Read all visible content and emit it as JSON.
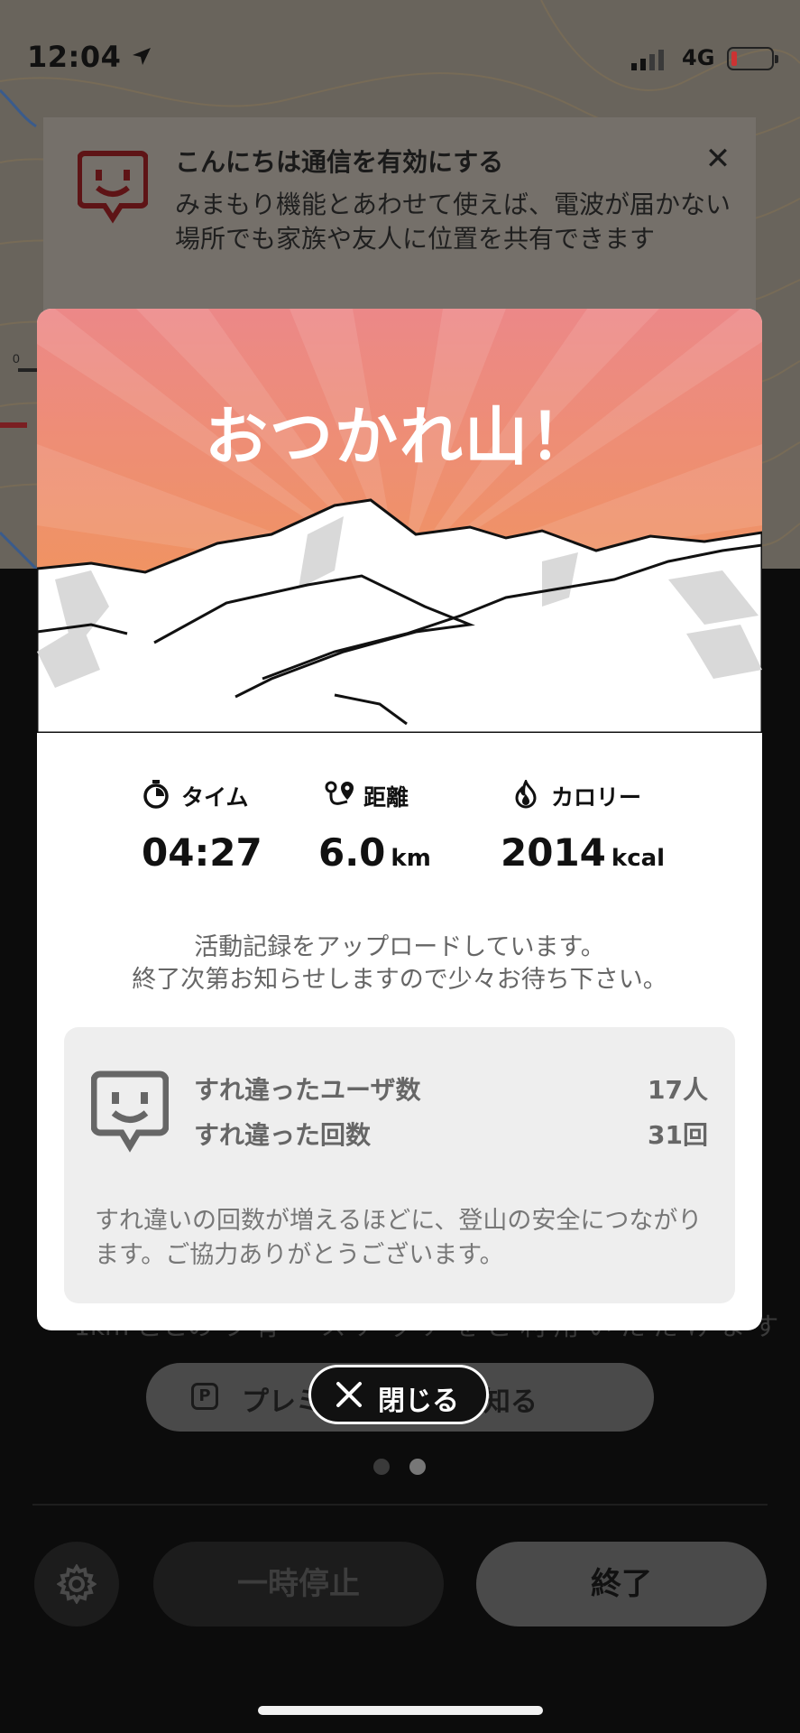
{
  "status_bar": {
    "time": "12:04",
    "network": "4G"
  },
  "notice": {
    "title": "こんにちは通信を有効にする",
    "body": "みまもり機能とあわせて使えば、電波が届かない場所でも家族や友人に位置を共有できます",
    "close_glyph": "✕"
  },
  "modal": {
    "title": "おつかれ山！",
    "stats": [
      {
        "label": "タイム",
        "value": "04:27",
        "unit": ""
      },
      {
        "label": "距離",
        "value": "6.0",
        "unit": "km"
      },
      {
        "label": "カロリー",
        "value": "2014",
        "unit": "kcal"
      }
    ],
    "upload_line1": "活動記録をアップロードしています。",
    "upload_line2": "終了次第お知らせしますので少々お待ち下さい。",
    "surechigai": {
      "rows": [
        {
          "label": "すれ違ったユーザ数",
          "value": "17人"
        },
        {
          "label": "すれ違った回数",
          "value": "31回"
        }
      ],
      "note": "すれ違いの回数が増えるほどに、登山の安全につながります。ご協力ありがとうございます。"
    },
    "close_label": "閉じる"
  },
  "background": {
    "premium_glyph": "P",
    "premium_label": "プレミアムを詳しく知る",
    "pause_label": "一時停止",
    "end_label": "終了"
  },
  "colors": {
    "hero_top": "#ec8c88",
    "hero_bottom": "#f09a50",
    "brand_red": "#c0262c",
    "card_gray": "#eeeeee"
  },
  "icons": [
    "location-arrow-icon",
    "signal-icon",
    "battery-icon",
    "chat-face-icon",
    "stopwatch-icon",
    "route-pin-icon",
    "flame-icon",
    "close-icon",
    "gear-icon"
  ]
}
